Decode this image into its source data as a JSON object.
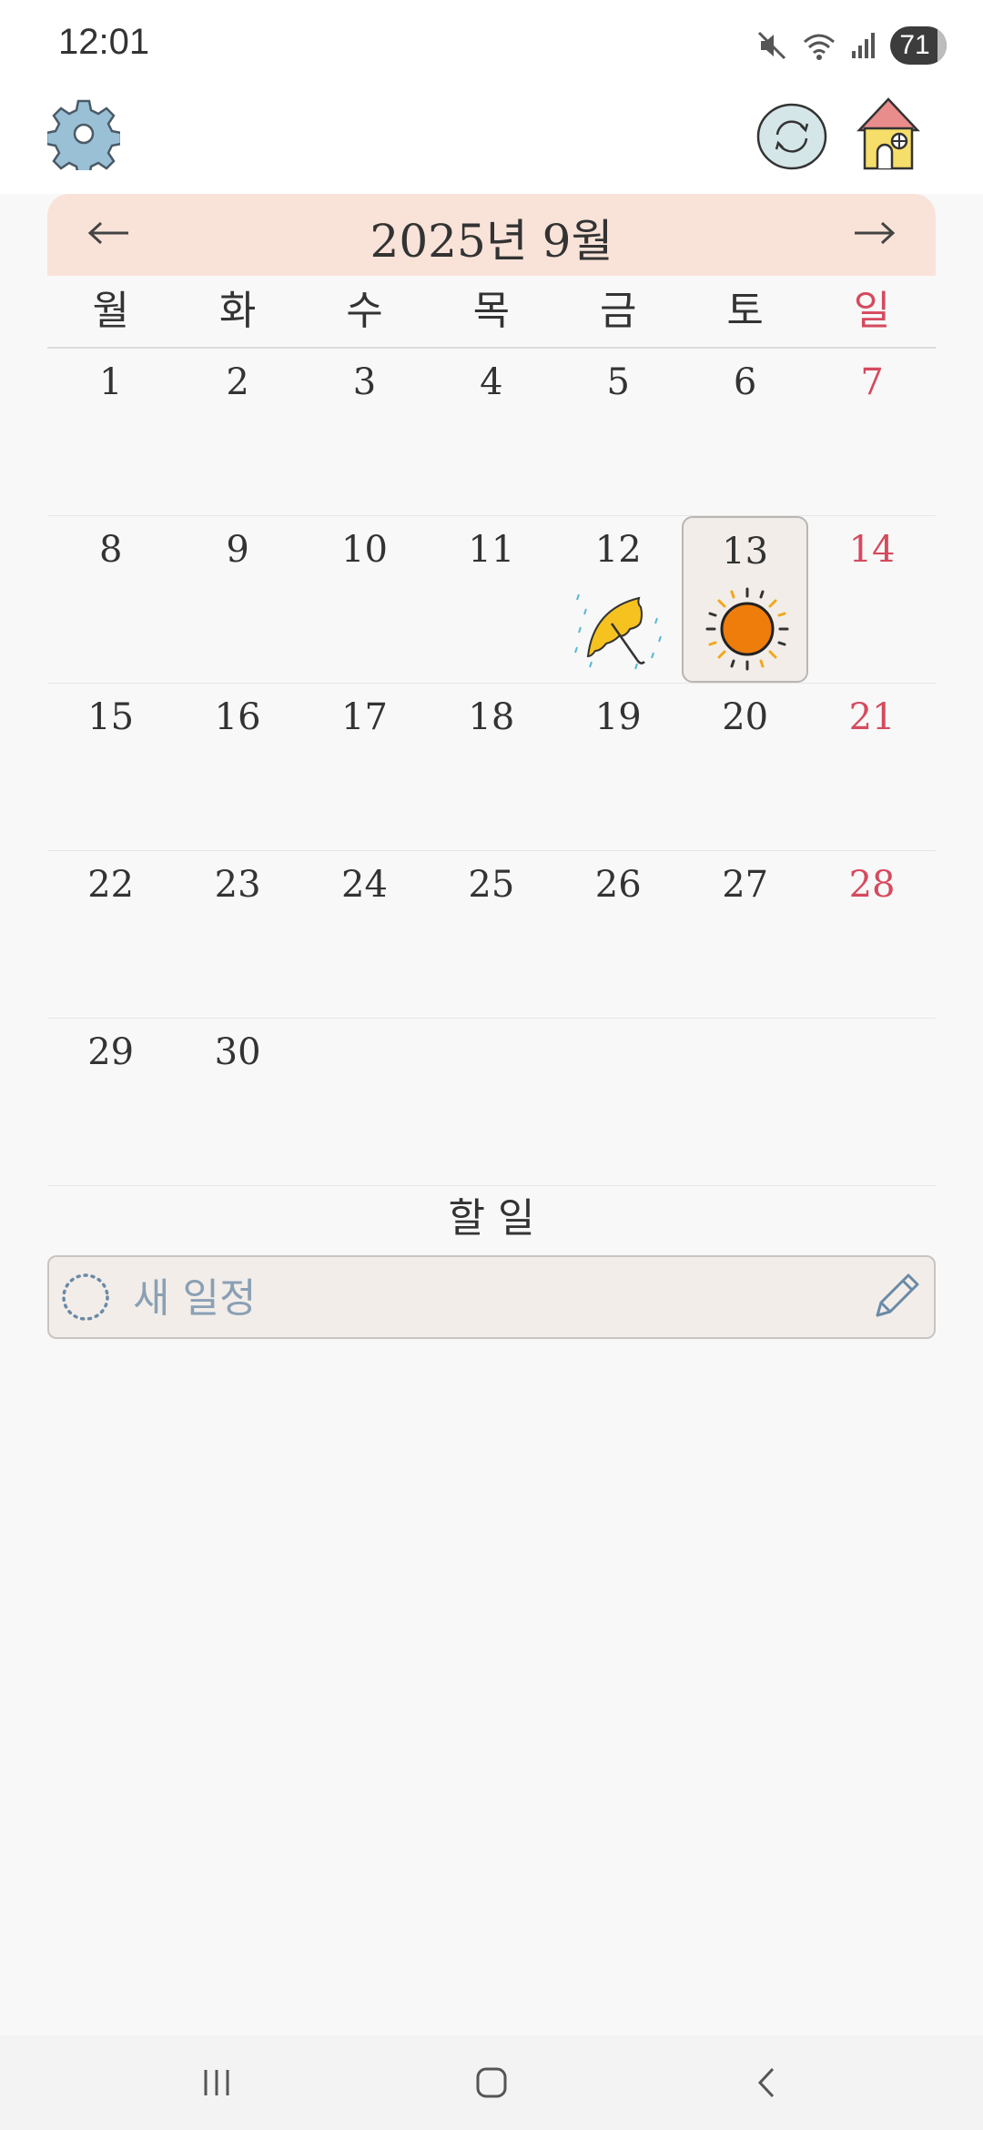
{
  "status_bar": {
    "time": "12:01",
    "battery": "71"
  },
  "calendar": {
    "month_title": "2025년 9월",
    "prev_arrow": "←",
    "next_arrow": "→",
    "weekdays": [
      "월",
      "화",
      "수",
      "목",
      "금",
      "토",
      "일"
    ],
    "weeks": [
      [
        "1",
        "2",
        "3",
        "4",
        "5",
        "6",
        "7"
      ],
      [
        "8",
        "9",
        "10",
        "11",
        "12",
        "13",
        "14"
      ],
      [
        "15",
        "16",
        "17",
        "18",
        "19",
        "20",
        "21"
      ],
      [
        "22",
        "23",
        "24",
        "25",
        "26",
        "27",
        "28"
      ],
      [
        "29",
        "30",
        "",
        "",
        "",
        "",
        ""
      ]
    ],
    "selected_day": "13",
    "weather": [
      {
        "day": "12",
        "icon": "umbrella-rain-icon"
      },
      {
        "day": "13",
        "icon": "sun-icon"
      }
    ],
    "colors": {
      "header_bg": "#f9e3d9",
      "sunday": "#d54a5e",
      "selected_bg": "#f2ede9"
    }
  },
  "todo": {
    "heading": "할 일",
    "placeholder": "새 일정"
  }
}
